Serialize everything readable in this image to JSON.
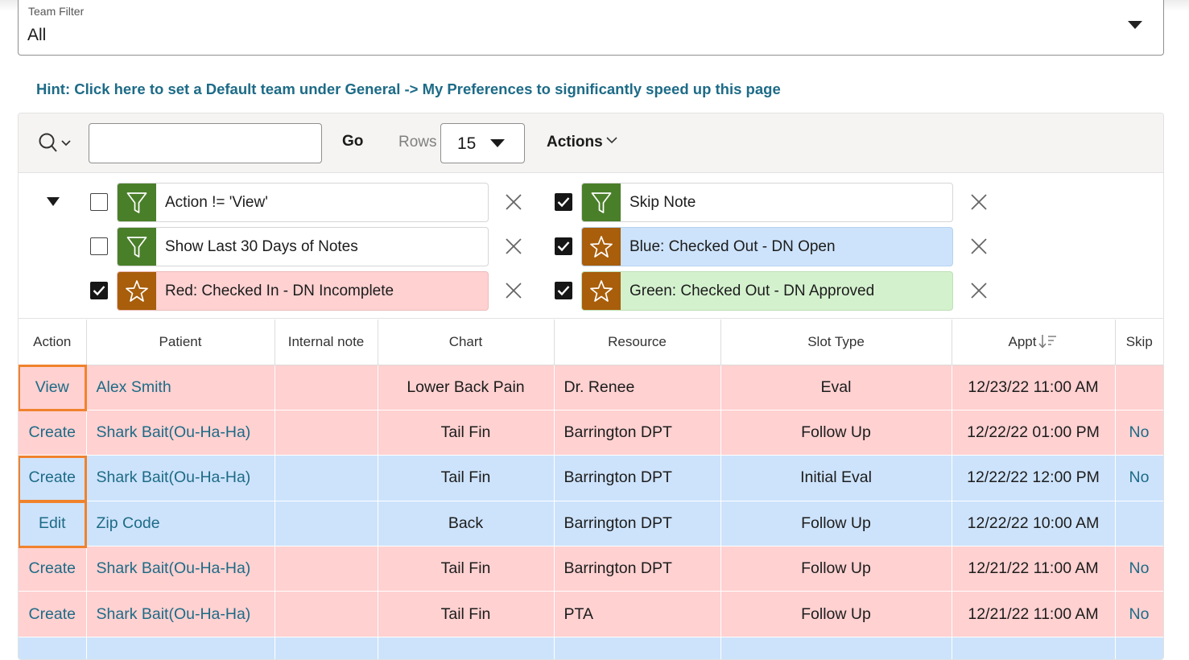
{
  "team_filter": {
    "label": "Team Filter",
    "value": "All"
  },
  "hint": "Hint: Click here to set a Default team under General -> My Preferences to significantly speed up this page",
  "toolbar": {
    "search_value": "",
    "go_label": "Go",
    "rows_label": "Rows",
    "rows_value": "15",
    "actions_label": "Actions"
  },
  "filters": [
    {
      "checked": false,
      "icon": "filter-icon",
      "badge_color": "#4a7f2a",
      "label": "Action != 'View'",
      "highlight": ""
    },
    {
      "checked": false,
      "icon": "filter-icon",
      "badge_color": "#4a7f2a",
      "label": "Show Last 30 Days of Notes",
      "highlight": ""
    },
    {
      "checked": true,
      "icon": "star-icon",
      "badge_color": "#a85e0b",
      "label": "Red: Checked In - DN Incomplete",
      "highlight": "#ffd1d1"
    },
    {
      "checked": true,
      "icon": "filter-icon",
      "badge_color": "#4a7f2a",
      "label": "Skip Note",
      "highlight": ""
    },
    {
      "checked": true,
      "icon": "star-icon",
      "badge_color": "#a85e0b",
      "label": "Blue: Checked Out - DN Open",
      "highlight": "#cde3fb"
    },
    {
      "checked": true,
      "icon": "star-icon",
      "badge_color": "#a85e0b",
      "label": "Green: Checked Out - DN Approved",
      "highlight": "#d4f1ce"
    }
  ],
  "table": {
    "columns": [
      "Action",
      "Patient",
      "Internal note",
      "Chart",
      "Resource",
      "Slot Type",
      "Appt",
      "Skip"
    ],
    "rows": [
      {
        "color": "red",
        "action": "View",
        "patient": "Alex Smith",
        "internal_note": "",
        "chart": "Lower Back Pain",
        "resource": "Dr. Renee",
        "slot_type": "Eval",
        "appt": "12/23/22 11:00 AM",
        "skip": ""
      },
      {
        "color": "red",
        "action": "Create",
        "patient": "Shark Bait(Ou-Ha-Ha)",
        "internal_note": "",
        "chart": "Tail Fin",
        "resource": "Barrington DPT",
        "slot_type": "Follow Up",
        "appt": "12/22/22 01:00 PM",
        "skip": "No"
      },
      {
        "color": "blue",
        "action": "Create",
        "patient": "Shark Bait(Ou-Ha-Ha)",
        "internal_note": "",
        "chart": "Tail Fin",
        "resource": "Barrington DPT",
        "slot_type": "Initial Eval",
        "appt": "12/22/22 12:00 PM",
        "skip": "No"
      },
      {
        "color": "blue",
        "action": "Edit",
        "patient": "Zip Code",
        "internal_note": "",
        "chart": "Back",
        "resource": "Barrington DPT",
        "slot_type": "Follow Up",
        "appt": "12/22/22 10:00 AM",
        "skip": ""
      },
      {
        "color": "red",
        "action": "Create",
        "patient": "Shark Bait(Ou-Ha-Ha)",
        "internal_note": "",
        "chart": "Tail Fin",
        "resource": "Barrington DPT",
        "slot_type": "Follow Up",
        "appt": "12/21/22 11:00 AM",
        "skip": "No"
      },
      {
        "color": "red",
        "action": "Create",
        "patient": "Shark Bait(Ou-Ha-Ha)",
        "internal_note": "",
        "chart": "Tail Fin",
        "resource": "PTA",
        "slot_type": "Follow Up",
        "appt": "12/21/22 11:00 AM",
        "skip": "No"
      },
      {
        "color": "blue",
        "action": "",
        "patient": "",
        "internal_note": "",
        "chart": "",
        "resource": "",
        "slot_type": "",
        "appt": "",
        "skip": ""
      }
    ],
    "highlighted_action_rows": [
      0,
      2,
      3
    ]
  },
  "colors": {
    "link": "#1d6b87",
    "row_red": "#ffd1d1",
    "row_blue": "#cde3fb",
    "highlight_box": "#f0822c"
  }
}
